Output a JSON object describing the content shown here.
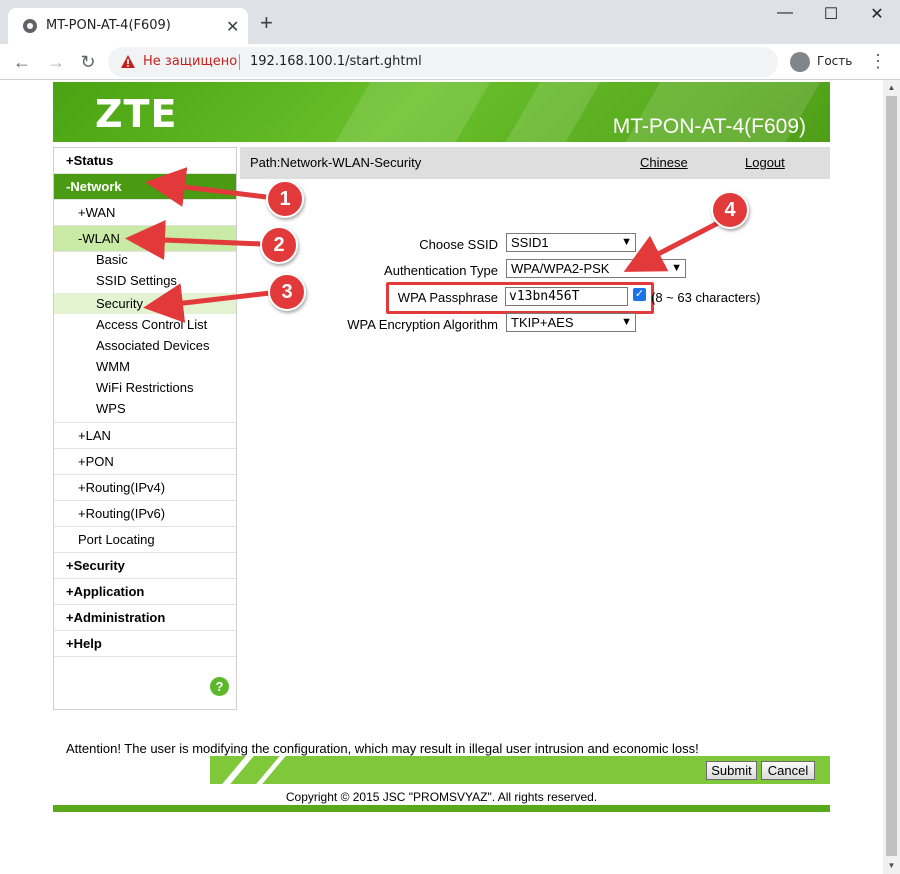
{
  "browser": {
    "tab_title": "MT-PON-AT-4(F609)",
    "security_label": "Не защищено",
    "url": "192.168.100.1/start.ghtml",
    "profile_label": "Гость"
  },
  "header": {
    "logo": "ZTE",
    "model": "MT-PON-AT-4(F609)"
  },
  "sidebar": {
    "items": [
      {
        "label": "+Status"
      },
      {
        "label": "-Network"
      },
      {
        "label": "+WAN"
      },
      {
        "label": "-WLAN"
      },
      {
        "label": "Basic"
      },
      {
        "label": "SSID Settings"
      },
      {
        "label": "Security"
      },
      {
        "label": "Access Control List"
      },
      {
        "label": "Associated Devices"
      },
      {
        "label": "WMM"
      },
      {
        "label": "WiFi Restrictions"
      },
      {
        "label": "WPS"
      },
      {
        "label": "+LAN"
      },
      {
        "label": "+PON"
      },
      {
        "label": "+Routing(IPv4)"
      },
      {
        "label": "+Routing(IPv6)"
      },
      {
        "label": "Port Locating"
      },
      {
        "label": "+Security"
      },
      {
        "label": "+Application"
      },
      {
        "label": "+Administration"
      },
      {
        "label": "+Help"
      }
    ],
    "help_glyph": "?"
  },
  "path": {
    "text": "Path:Network-WLAN-Security",
    "chinese": "Chinese",
    "logout": "Logout"
  },
  "form": {
    "ssid_label": "Choose SSID",
    "ssid_value": "SSID1",
    "auth_label": "Authentication Type",
    "auth_value": "WPA/WPA2-PSK",
    "pass_label": "WPA Passphrase",
    "pass_value": "v13bn456T",
    "pass_shown": true,
    "pass_hint": "(8 ~ 63 characters)",
    "enc_label": "WPA Encryption Algorithm",
    "enc_value": "TKIP+AES"
  },
  "footer": {
    "attention": "Attention! The user is modifying the configuration, which may result in illegal user intrusion and economic loss!",
    "submit": "Submit",
    "cancel": "Cancel",
    "copyright": "Copyright © 2015 JSC \"PROMSVYAZ\". All rights reserved."
  },
  "annotations": {
    "badges": [
      "1",
      "2",
      "3",
      "4"
    ],
    "color": "#e23a3a"
  },
  "colors": {
    "brand_green": "#4a9b13",
    "light_green": "#c8eaa5",
    "accent_red": "#e23a3a"
  }
}
